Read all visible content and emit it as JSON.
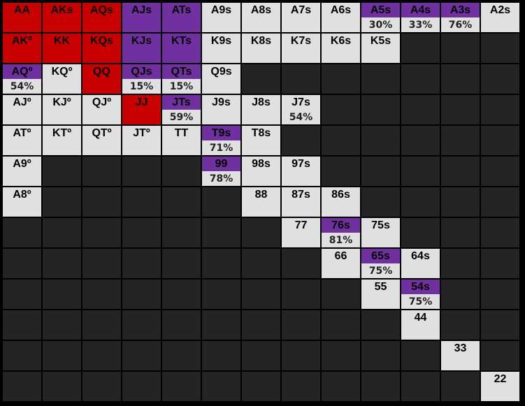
{
  "colors": {
    "raise": "#c80000",
    "mixed": "#7030a0",
    "fold": "#e0e0e0",
    "empty": "#242424"
  },
  "rows": [
    [
      {
        "label": "AA",
        "color": "red"
      },
      {
        "label": "AKs",
        "color": "red"
      },
      {
        "label": "AQs",
        "color": "red"
      },
      {
        "label": "AJs",
        "color": "purple"
      },
      {
        "label": "ATs",
        "color": "purple"
      },
      {
        "label": "A9s",
        "color": "light"
      },
      {
        "label": "A8s",
        "color": "light"
      },
      {
        "label": "A7s",
        "color": "light"
      },
      {
        "label": "A6s",
        "color": "light"
      },
      {
        "label": "A5s",
        "color": "purple",
        "pct": "30%"
      },
      {
        "label": "A4s",
        "color": "purple",
        "pct": "33%"
      },
      {
        "label": "A3s",
        "color": "purple",
        "pct": "76%"
      },
      {
        "label": "A2s",
        "color": "light"
      }
    ],
    [
      {
        "label": "AKº",
        "color": "red"
      },
      {
        "label": "KK",
        "color": "red"
      },
      {
        "label": "KQs",
        "color": "red"
      },
      {
        "label": "KJs",
        "color": "purple"
      },
      {
        "label": "KTs",
        "color": "purple"
      },
      {
        "label": "K9s",
        "color": "light"
      },
      {
        "label": "K8s",
        "color": "light"
      },
      {
        "label": "K7s",
        "color": "light"
      },
      {
        "label": "K6s",
        "color": "light"
      },
      {
        "label": "K5s",
        "color": "light"
      },
      null,
      null,
      null
    ],
    [
      {
        "label": "AQº",
        "color": "purple",
        "pct": "54%"
      },
      {
        "label": "KQº",
        "color": "light"
      },
      {
        "label": "QQ",
        "color": "red"
      },
      {
        "label": "QJs",
        "color": "purple",
        "pct": "15%"
      },
      {
        "label": "QTs",
        "color": "purple",
        "pct": "15%"
      },
      {
        "label": "Q9s",
        "color": "light"
      },
      null,
      null,
      null,
      null,
      null,
      null,
      null
    ],
    [
      {
        "label": "AJº",
        "color": "light"
      },
      {
        "label": "KJº",
        "color": "light"
      },
      {
        "label": "QJº",
        "color": "light"
      },
      {
        "label": "JJ",
        "color": "red"
      },
      {
        "label": "JTs",
        "color": "purple",
        "pct": "59%"
      },
      {
        "label": "J9s",
        "color": "light"
      },
      {
        "label": "J8s",
        "color": "light"
      },
      {
        "label": "J7s",
        "color": "light",
        "pct": "54%"
      },
      null,
      null,
      null,
      null,
      null
    ],
    [
      {
        "label": "ATº",
        "color": "light"
      },
      {
        "label": "KTº",
        "color": "light"
      },
      {
        "label": "QTº",
        "color": "light"
      },
      {
        "label": "JTº",
        "color": "light"
      },
      {
        "label": "TT",
        "color": "light"
      },
      {
        "label": "T9s",
        "color": "purple",
        "pct": "71%"
      },
      {
        "label": "T8s",
        "color": "light"
      },
      null,
      null,
      null,
      null,
      null,
      null
    ],
    [
      {
        "label": "A9º",
        "color": "light"
      },
      null,
      null,
      null,
      null,
      {
        "label": "99",
        "color": "purple",
        "pct": "78%"
      },
      {
        "label": "98s",
        "color": "light"
      },
      {
        "label": "97s",
        "color": "light"
      },
      null,
      null,
      null,
      null,
      null
    ],
    [
      {
        "label": "A8º",
        "color": "light"
      },
      null,
      null,
      null,
      null,
      null,
      {
        "label": "88",
        "color": "light"
      },
      {
        "label": "87s",
        "color": "light"
      },
      {
        "label": "86s",
        "color": "light"
      },
      null,
      null,
      null,
      null
    ],
    [
      null,
      null,
      null,
      null,
      null,
      null,
      null,
      {
        "label": "77",
        "color": "light"
      },
      {
        "label": "76s",
        "color": "purple",
        "pct": "81%"
      },
      {
        "label": "75s",
        "color": "light"
      },
      null,
      null,
      null
    ],
    [
      null,
      null,
      null,
      null,
      null,
      null,
      null,
      null,
      {
        "label": "66",
        "color": "light"
      },
      {
        "label": "65s",
        "color": "purple",
        "pct": "75%"
      },
      {
        "label": "64s",
        "color": "light"
      },
      null,
      null
    ],
    [
      null,
      null,
      null,
      null,
      null,
      null,
      null,
      null,
      null,
      {
        "label": "55",
        "color": "light"
      },
      {
        "label": "54s",
        "color": "purple",
        "pct": "75%"
      },
      null,
      null
    ],
    [
      null,
      null,
      null,
      null,
      null,
      null,
      null,
      null,
      null,
      null,
      {
        "label": "44",
        "color": "light"
      },
      null,
      null
    ],
    [
      null,
      null,
      null,
      null,
      null,
      null,
      null,
      null,
      null,
      null,
      null,
      {
        "label": "33",
        "color": "light"
      },
      null
    ],
    [
      null,
      null,
      null,
      null,
      null,
      null,
      null,
      null,
      null,
      null,
      null,
      null,
      {
        "label": "22",
        "color": "light"
      }
    ]
  ]
}
